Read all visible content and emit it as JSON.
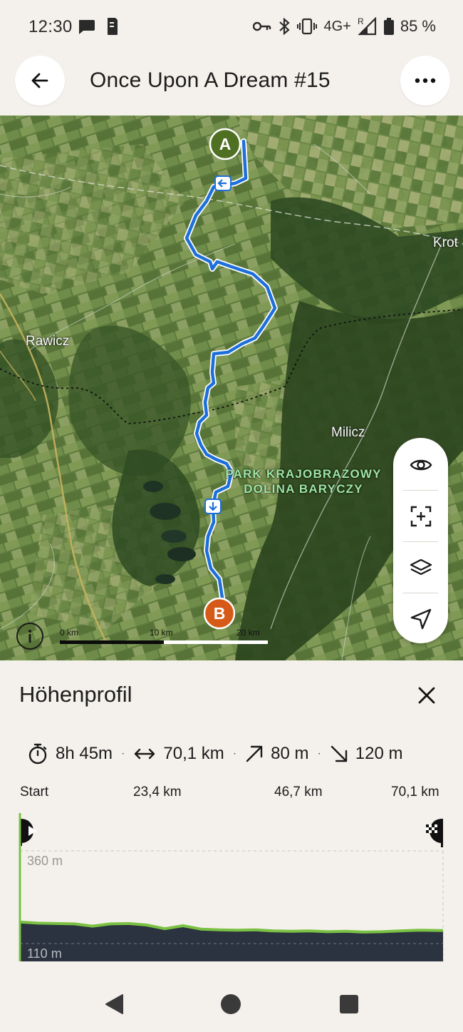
{
  "status_bar": {
    "time": "12:30",
    "network": "4G+",
    "roaming": "R",
    "battery": "85 %",
    "icons": [
      "message-icon",
      "sim-icon",
      "key-icon",
      "bluetooth-icon",
      "vibrate-icon",
      "signal-icon",
      "battery-icon"
    ]
  },
  "header": {
    "title": "Once Upon A Dream #15",
    "back_icon": "arrow-left-icon",
    "more_icon": "more-horizontal-icon"
  },
  "map": {
    "labels": {
      "rawicz": "Rawicz",
      "milicz": "Milicz",
      "krot": "Krot",
      "park_line1": "PARK KRAJOBRAZOWY",
      "park_line2": "DOLINA BARYCZY"
    },
    "start_marker": "A",
    "end_marker": "B",
    "scale": {
      "labels": [
        "0 km",
        "10 km",
        "20 km"
      ]
    },
    "route_color": "#1e6fd9",
    "controls": [
      "eye-icon",
      "focus-add-icon",
      "layers-icon",
      "navigate-icon"
    ]
  },
  "elevation": {
    "title": "Höhenprofil",
    "stats": {
      "duration": "8h 45m",
      "distance": "70,1 km",
      "ascent": "80 m",
      "descent": "120 m"
    },
    "distance_labels": [
      "Start",
      "23,4 km",
      "46,7 km",
      "70,1 km"
    ],
    "y_labels": {
      "top": "360 m",
      "bottom": "110 m"
    },
    "chart_data": {
      "type": "area",
      "x_label": "",
      "y_label": "",
      "xlim": [
        0,
        70.1
      ],
      "ylim": [
        110,
        360
      ],
      "x": [
        0,
        3,
        6,
        9,
        12,
        15,
        18,
        21,
        24,
        27,
        30,
        33,
        36,
        39,
        42,
        45,
        48,
        51,
        54,
        57,
        60,
        63,
        66,
        70.1
      ],
      "y": [
        168,
        165,
        164,
        163,
        157,
        163,
        164,
        160,
        150,
        158,
        149,
        147,
        146,
        147,
        144,
        143,
        144,
        142,
        143,
        141,
        142,
        144,
        146,
        145
      ],
      "line_color": "#7ac143",
      "fill_color": "#2b3340"
    }
  },
  "nav_bar": {
    "items": [
      "back-triangle-icon",
      "home-circle-icon",
      "recents-square-icon"
    ]
  }
}
